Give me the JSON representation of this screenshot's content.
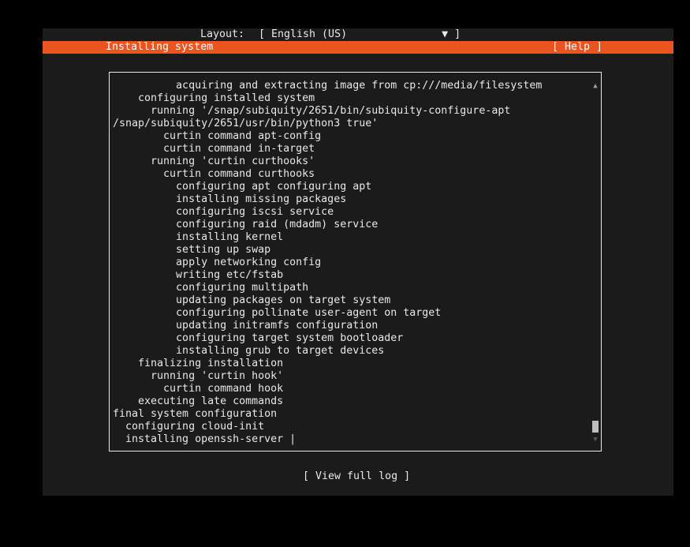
{
  "header": {
    "layout_label": "Layout:",
    "layout_value": "[ English (US)               ▼ ]"
  },
  "title_bar": {
    "title": "Installing system",
    "help_label": "[ Help ]",
    "color": "#e95420"
  },
  "log": {
    "lines": [
      "          acquiring and extracting image from cp:///media/filesystem",
      "    configuring installed system",
      "      running '/snap/subiquity/2651/bin/subiquity-configure-apt",
      "/snap/subiquity/2651/usr/bin/python3 true'",
      "        curtin command apt-config",
      "        curtin command in-target",
      "      running 'curtin curthooks'",
      "        curtin command curthooks",
      "          configuring apt configuring apt",
      "          installing missing packages",
      "          configuring iscsi service",
      "          configuring raid (mdadm) service",
      "          installing kernel",
      "          setting up swap",
      "          apply networking config",
      "          writing etc/fstab",
      "          configuring multipath",
      "          updating packages on target system",
      "          configuring pollinate user-agent on target",
      "          updating initramfs configuration",
      "          configuring target system bootloader",
      "          installing grub to target devices",
      "    finalizing installation",
      "      running 'curtin hook'",
      "        curtin command hook",
      "    executing late commands",
      "final system configuration",
      "  configuring cloud-init",
      "  installing openssh-server |"
    ]
  },
  "scrollbar": {
    "up_icon": "▲",
    "down_icon": "▼"
  },
  "footer": {
    "view_log_label": "[ View full log ]"
  }
}
